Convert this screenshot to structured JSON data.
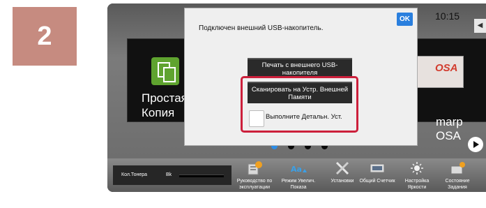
{
  "step_number": "2",
  "status": {
    "clock": "10:15"
  },
  "home": {
    "tile_left": {
      "label": "Простая Копия"
    },
    "tile_right": {
      "label": "marp OSA",
      "photo_text": "OSA"
    }
  },
  "dialog": {
    "message": "Подключен внешний USB-накопитель.",
    "ok_label": "OK",
    "print_button": "Печать с внешнего USB-накопителя",
    "scan_button": "Сканировать на Устр. Внешней Памяти",
    "detail_checkbox": "Выполните Детальн. Уст."
  },
  "toner": {
    "label": "Кол.Тонера",
    "color": "Bk"
  },
  "shortcuts": [
    {
      "label": "Руководство по эксплуатации",
      "icon": "manual-icon"
    },
    {
      "label": "Режим Увелич. Показа",
      "icon": "magnify-mode-icon"
    },
    {
      "label": "Установки",
      "icon": "settings-tools-icon"
    },
    {
      "label": "Общий Счетчик",
      "icon": "counter-icon"
    },
    {
      "label": "Настройка Яркости",
      "icon": "brightness-icon"
    },
    {
      "label": "Состояние Задания",
      "icon": "job-status-icon"
    }
  ],
  "colors": {
    "highlight": "#cc1f3b",
    "ok_button": "#2a7fde",
    "step_badge": "#c68b80",
    "active_dot": "#2d8de6"
  }
}
